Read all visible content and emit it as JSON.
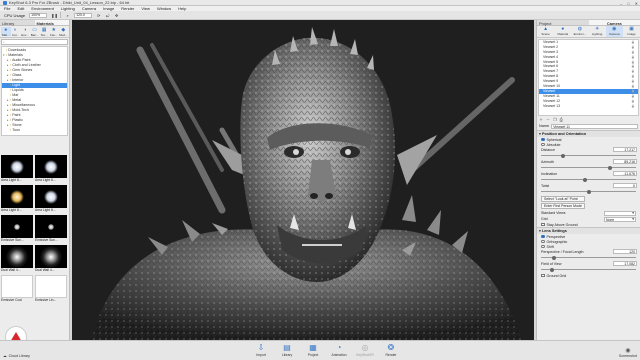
{
  "window": {
    "title": "KeyShot 6.3 Pro For ZBrush - Dhiki_Unit_04_Lesson_22.bip - 64 bit",
    "controls": [
      "–",
      "□",
      "✕"
    ]
  },
  "menubar": [
    "File",
    "Edit",
    "Environment",
    "Lighting",
    "Camera",
    "Image",
    "Render",
    "View",
    "Window",
    "Help"
  ],
  "toolbar": {
    "cpu_label": "CPU Usage",
    "cpu_value": "100%",
    "zoom_value": "120.0"
  },
  "library": {
    "tabs": [
      "Library",
      "Materials"
    ],
    "icons": [
      "Mat...",
      "Col...",
      "Env...",
      "Bac...",
      "Tex...",
      "Fav...",
      "Mod..."
    ],
    "search_placeholder": "",
    "tree": [
      {
        "label": "Downloads",
        "indent": 0,
        "arrow": ""
      },
      {
        "label": "Materials",
        "indent": 0,
        "arrow": "▾"
      },
      {
        "label": "Audio Paint",
        "indent": 1,
        "arrow": "▸"
      },
      {
        "label": "Cloth and Leather",
        "indent": 1,
        "arrow": "▸"
      },
      {
        "label": "Gem Stones",
        "indent": 1,
        "arrow": "▸"
      },
      {
        "label": "Glass",
        "indent": 1,
        "arrow": "▸"
      },
      {
        "label": "Interior",
        "indent": 1,
        "arrow": "▸"
      },
      {
        "label": "Light",
        "indent": 1,
        "arrow": "▸",
        "selected": true
      },
      {
        "label": "Liquids",
        "indent": 1,
        "arrow": ""
      },
      {
        "label": "Mat",
        "indent": 1,
        "arrow": ""
      },
      {
        "label": "Metal",
        "indent": 1,
        "arrow": "▸"
      },
      {
        "label": "Miscellaneous",
        "indent": 1,
        "arrow": "▸"
      },
      {
        "label": "Mold-Tech",
        "indent": 1,
        "arrow": "▸"
      },
      {
        "label": "Paint",
        "indent": 1,
        "arrow": "▸"
      },
      {
        "label": "Plastic",
        "indent": 1,
        "arrow": "▸"
      },
      {
        "label": "Stone",
        "indent": 1,
        "arrow": "▸"
      },
      {
        "label": "Toon",
        "indent": 1,
        "arrow": ""
      }
    ],
    "thumbnails": [
      {
        "label": "Area Light 8...",
        "style": "soft"
      },
      {
        "label": "Area Light 8...",
        "style": "soft"
      },
      {
        "label": "Area Light 8...",
        "style": "warm"
      },
      {
        "label": "Area Light 8...",
        "style": "soft"
      },
      {
        "label": "Emissive Sun...",
        "style": "small"
      },
      {
        "label": "Emissive Sun...",
        "style": "small"
      },
      {
        "label": "Dual Wall 4...",
        "style": "flare"
      },
      {
        "label": "Dual Wall 4...",
        "style": "flare"
      },
      {
        "label": "Emissive Cool",
        "style": "white"
      },
      {
        "label": "Emissive Lin...",
        "style": "white"
      }
    ]
  },
  "project": {
    "tabs": [
      "Project",
      "Camera"
    ],
    "icons": [
      "Scene",
      "Material",
      "Environ...",
      "Lighting",
      "Camera",
      "Image"
    ],
    "cameras": [
      "Viewset 1",
      "Viewset 2",
      "Viewset 3",
      "Viewset 4",
      "Viewset 5",
      "Viewset 6",
      "Viewset 7",
      "Viewset 8",
      "Viewset 9",
      "Viewset 10",
      "Viewset",
      "Viewset 11",
      "Viewset 12",
      "Viewset 13"
    ],
    "selected_camera_index": 10,
    "name_label": "Name",
    "name_value": "Viewset 11",
    "position_section": "Position and Orientation",
    "mode_options": [
      "Spherical",
      "Absolute"
    ],
    "mode_selected": "Spherical",
    "params": [
      {
        "label": "Distance",
        "value": "17.217",
        "level": 0.22
      },
      {
        "label": "Azimuth",
        "value": "85.216",
        "level": 0.73
      },
      {
        "label": "Inclination",
        "value": "-11.676",
        "level": 0.46
      },
      {
        "label": "Twist",
        "value": "0",
        "level": 0.5
      }
    ],
    "look_at_button": "Select \"Look at\" Point",
    "first_person_button": "Enter First Person Mode",
    "standard_views_label": "Standard Views",
    "standard_views_value": "",
    "grid_label": "Grid",
    "grid_value": "None",
    "stay_above_ground": "Stay Above Ground",
    "lens_section": "Lens Settings",
    "lens_options": [
      "Perspective",
      "Orthographic",
      "Shift"
    ],
    "lens_selected": "Perspective",
    "focal_label": "Perspective / Focal Length",
    "focal_value": "120",
    "focal_level": 0.12,
    "fov_label": "Field of View",
    "fov_value": "17.082",
    "fov_level": 0.1,
    "ground_grid": "Ground Grid"
  },
  "bottombar": {
    "cloud_library": "Cloud Library",
    "buttons": [
      {
        "label": "Import",
        "icon": "⇩",
        "enabled": true
      },
      {
        "label": "Library",
        "icon": "▤",
        "enabled": true
      },
      {
        "label": "Project",
        "icon": "▦",
        "enabled": true
      },
      {
        "label": "Animation",
        "icon": "◔",
        "enabled": true
      },
      {
        "label": "KeyShotXR",
        "icon": "◎",
        "enabled": false
      },
      {
        "label": "Render",
        "icon": "❂",
        "enabled": true
      }
    ],
    "screenshot": "Screenshot"
  }
}
